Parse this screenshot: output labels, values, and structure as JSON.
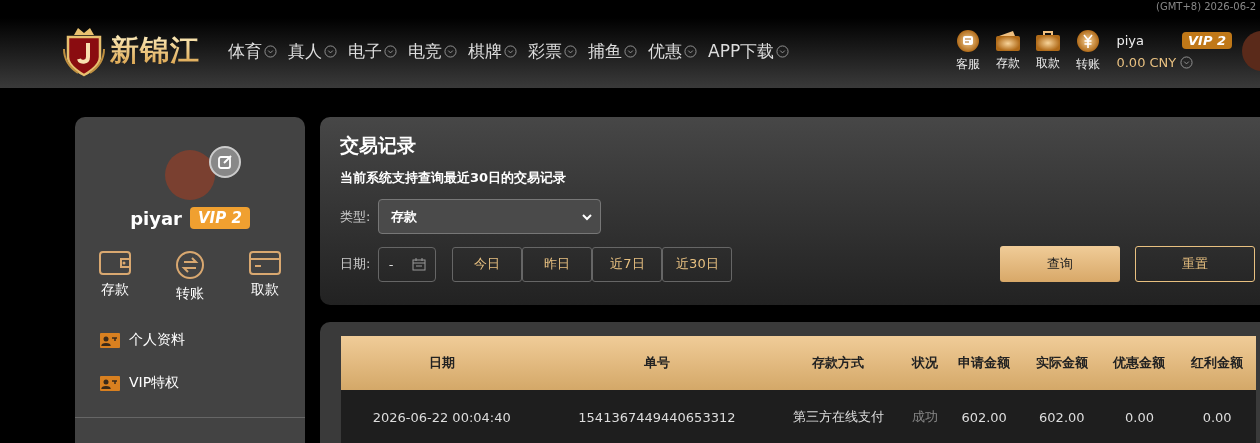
{
  "header": {
    "clock": "(GMT+8) 2026-06-2",
    "logo_text": "新锦江",
    "nav": [
      "体育",
      "真人",
      "电子",
      "电竞",
      "棋牌",
      "彩票",
      "捕鱼",
      "优惠",
      "APP下载"
    ],
    "actions": [
      {
        "kind": "chat",
        "label": "客服"
      },
      {
        "kind": "wallet",
        "label": "存款"
      },
      {
        "kind": "case",
        "label": "取款"
      },
      {
        "kind": "yuan",
        "label": "转账"
      }
    ],
    "user": {
      "name": "piya",
      "vip": "VIP 2",
      "balance": "0.00 CNY"
    }
  },
  "sidebar": {
    "name": "piyar",
    "vip": "VIP 2",
    "actions": [
      {
        "kind": "wallet",
        "label": "存款"
      },
      {
        "kind": "transfer",
        "label": "转账"
      },
      {
        "kind": "card",
        "label": "取款"
      }
    ],
    "menu": [
      "个人资料",
      "VIP特权"
    ]
  },
  "filter": {
    "title": "交易记录",
    "note": "当前系统支持查询最近30日的交易记录",
    "type_label": "类型:",
    "type_value": "存款",
    "date_label": "日期:",
    "date_value": "-",
    "quick": [
      "今日",
      "昨日",
      "近7日",
      "近30日"
    ],
    "search_button": "查询",
    "reset_button": "重置"
  },
  "table": {
    "columns": [
      "日期",
      "单号",
      "存款方式",
      "状况",
      "申请金额",
      "实际金额",
      "优惠金额",
      "红利金额"
    ],
    "rows": [
      [
        "2026-06-22 00:04:40",
        "1541367449440653312",
        "第三方在线支付",
        "成功",
        "602.00",
        "602.00",
        "0.00",
        "0.00"
      ]
    ]
  }
}
